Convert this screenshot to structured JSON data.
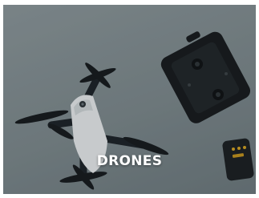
{
  "category_card": {
    "label": "DRONES",
    "image_alt": "drones-photo"
  },
  "colors": {
    "label_text": "#ffffff",
    "background": "#8a9598"
  }
}
